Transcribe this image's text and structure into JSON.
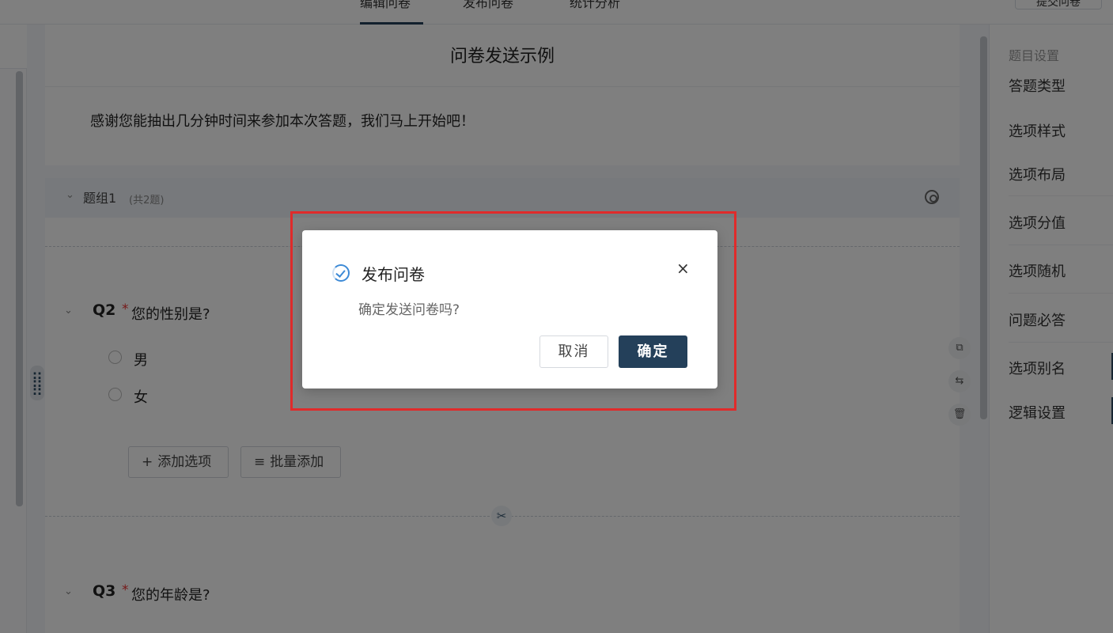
{
  "topbar": {
    "tabs": [
      "编辑问卷",
      "发布问卷",
      "统计分析"
    ],
    "action_button": "提交问卷"
  },
  "survey": {
    "title": "问卷发送示例",
    "intro": "感谢您能抽出几分钟时间来参加本次答题，我们马上开始吧！",
    "group": {
      "title": "题组1",
      "count": "(共2题)"
    },
    "questions": [
      {
        "num": "Q2",
        "required_mark": "*",
        "text": "您的性别是?",
        "options": [
          "男",
          "女"
        ]
      },
      {
        "num": "Q3",
        "required_mark": "*",
        "text": "您的年龄是?"
      }
    ],
    "add_option_label": "添加选项",
    "batch_add_label": "批量添加"
  },
  "right_panel": {
    "heading": "题目设置",
    "items": [
      "答题类型",
      "选项样式",
      "选项布局",
      "选项分值",
      "选项随机",
      "问题必答",
      "选项别名",
      "逻辑设置"
    ]
  },
  "dialog": {
    "title": "发布问卷",
    "message": "确定发送问卷吗?",
    "cancel_label": "取消",
    "ok_label": "确定",
    "close_glyph": "×"
  }
}
